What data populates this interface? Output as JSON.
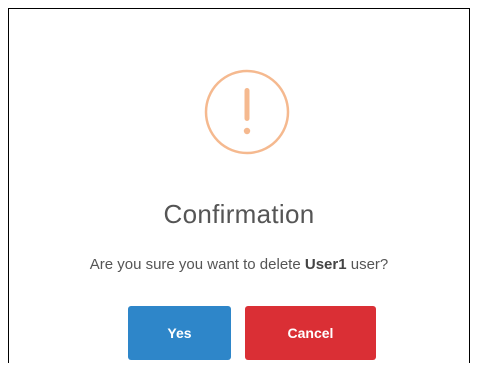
{
  "dialog": {
    "icon": "exclamation-circle-icon",
    "icon_color": "#f5b98f",
    "title": "Confirmation",
    "message_prefix": "Are you sure you want to delete ",
    "message_target": "User1",
    "message_suffix": " user?",
    "yes_label": "Yes",
    "cancel_label": "Cancel",
    "yes_color": "#2e86c9",
    "cancel_color": "#da2f35"
  }
}
